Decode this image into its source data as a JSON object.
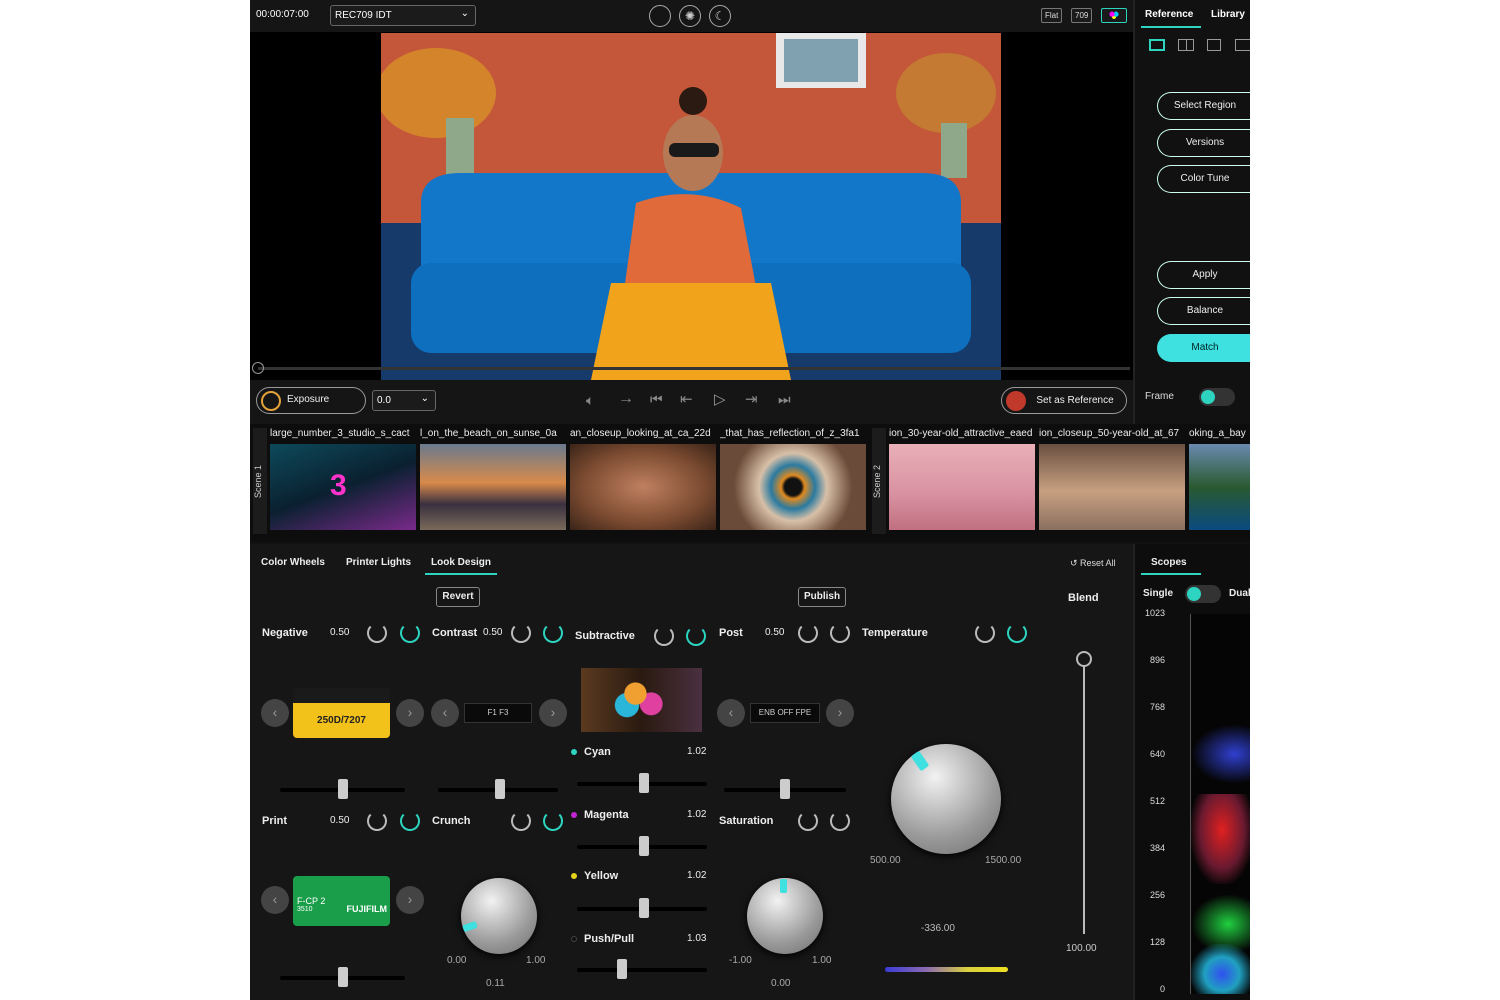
{
  "topbar": {
    "timecode": "00:00:07:00",
    "idt": "REC709 IDT",
    "flat": "Flat",
    "rec709": "709"
  },
  "right_tabs": {
    "reference": "Reference",
    "library": "Library"
  },
  "right_buttons": {
    "select_region": "Select Region",
    "versions": "Versions",
    "color_tune": "Color Tune",
    "apply": "Apply",
    "balance": "Balance",
    "match": "Match",
    "frame": "Frame"
  },
  "controls": {
    "exposure": "Exposure",
    "exposure_value": "0.0",
    "set_reference": "Set as Reference"
  },
  "filmstrip": {
    "scene1": "Scene 1",
    "scene2": "Scene 2",
    "labels": [
      "large_number_3_studio_s_cact",
      "l_on_the_beach_on_sunse_0a",
      "an_closeup_looking_at_ca_22d",
      "_that_has_reflection_of_z_3fa1",
      "ion_30-year-old_attractive_eaed",
      "ion_closeup_50-year-old_at_67",
      "oking_a_bay"
    ]
  },
  "tabs": {
    "color_wheels": "Color Wheels",
    "printer_lights": "Printer Lights",
    "look_design": "Look Design",
    "reset_all": "Reset All",
    "scopes": "Scopes"
  },
  "buttons": {
    "revert": "Revert",
    "publish": "Publish"
  },
  "panel": {
    "negative": "Negative",
    "negative_value": "0.50",
    "negative_film": "250D/7207",
    "print": "Print",
    "print_value": "0.50",
    "print_film": "F-CP 2",
    "print_film_code": "3510",
    "print_brand": "FUJIFILM",
    "contrast": "Contrast",
    "contrast_value": "0.50",
    "contrast_opts": "F1  F3",
    "crunch": "Crunch",
    "crunch_min": "0.00",
    "crunch_max": "1.00",
    "crunch_value": "0.11",
    "subtractive": "Subtractive",
    "cyan": "Cyan",
    "cyan_value": "1.02",
    "magenta": "Magenta",
    "magenta_value": "1.02",
    "yellow": "Yellow",
    "yellow_value": "1.02",
    "pushpull": "Push/Pull",
    "pushpull_value": "1.03",
    "post": "Post",
    "post_value": "0.50",
    "post_opts": "ENB  OFF  FPE",
    "saturation": "Saturation",
    "sat_min": "-1.00",
    "sat_max": "1.00",
    "sat_value": "0.00",
    "temperature": "Temperature",
    "temp_min": "500.00",
    "temp_max": "1500.00",
    "temp_value": "-336.00",
    "blend": "Blend",
    "blend_value": "100.00"
  },
  "scopes": {
    "single": "Single",
    "dual": "Dual",
    "scale": [
      "1023",
      "896",
      "768",
      "640",
      "512",
      "384",
      "256",
      "128",
      "0"
    ]
  },
  "colors": {
    "accent": "#2dd4bf",
    "accent_fill": "#3ee0e0"
  }
}
